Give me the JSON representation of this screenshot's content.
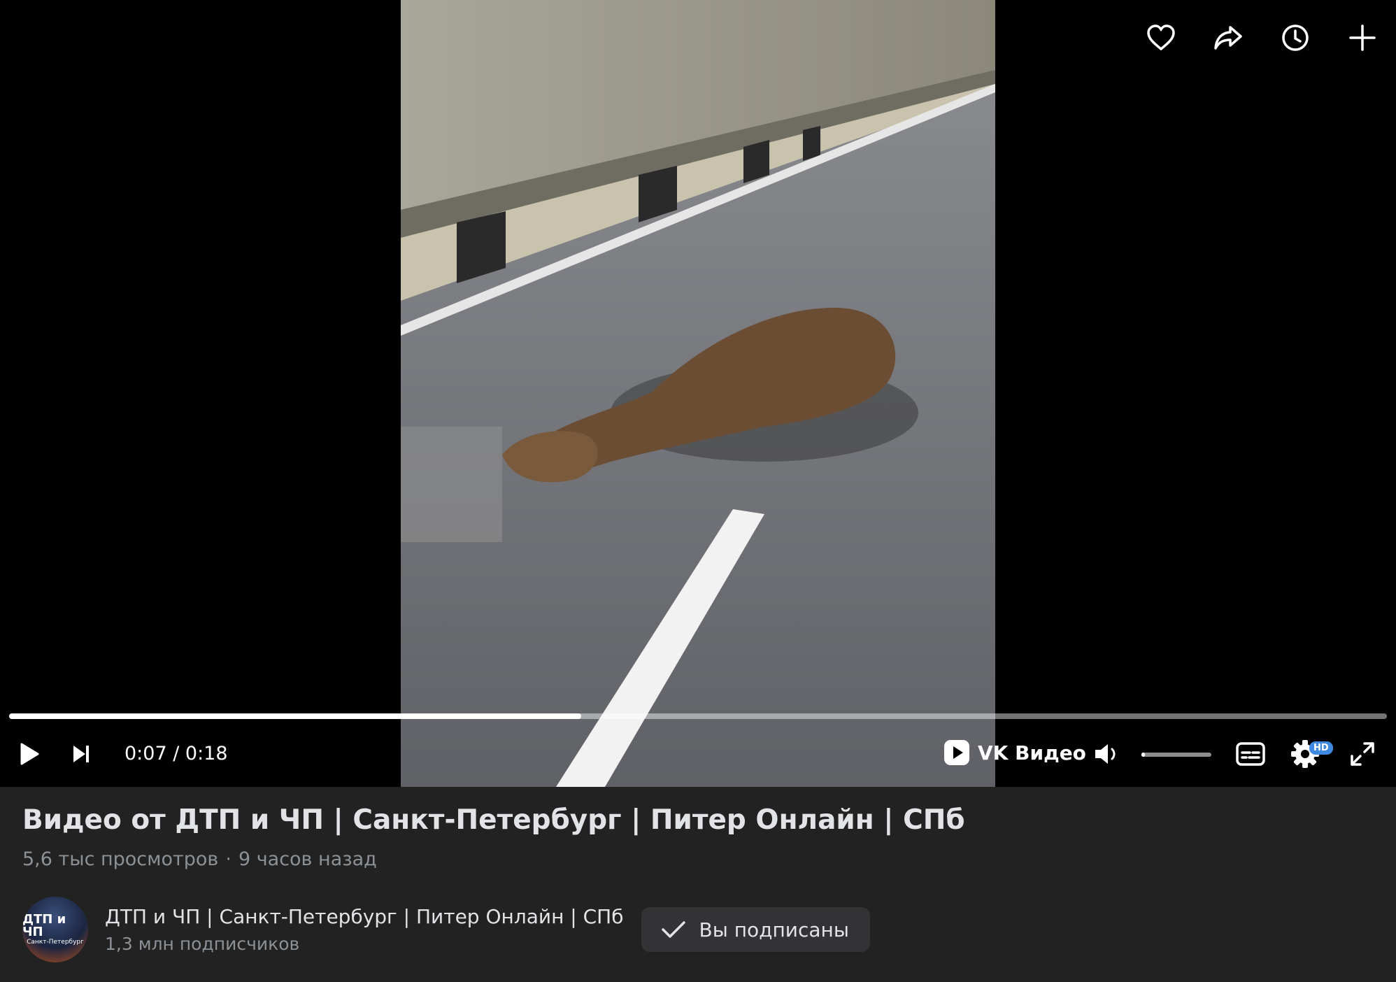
{
  "player": {
    "time_current": "0:07",
    "time_separator": " / ",
    "time_duration": "0:18",
    "progress_fraction": 0.415,
    "volume_fraction": 0.05,
    "brand_label": "VK Видео",
    "hd_badge": "HD",
    "top_icons": [
      "heart-icon",
      "share-icon",
      "clock-icon",
      "plus-icon"
    ],
    "control_icons": [
      "play-icon",
      "next-icon",
      "vk-video-logo-icon",
      "volume-icon",
      "subtitles-icon",
      "settings-icon",
      "fullscreen-icon"
    ]
  },
  "video": {
    "title": "Видео от ДТП и ЧП | Санкт-Петербург | Питер Онлайн | СПб",
    "views": "5,6 тыс просмотров",
    "separator": "·",
    "age": "9 часов назад"
  },
  "channel": {
    "name": "ДТП и ЧП | Санкт-Петербург | Питер Онлайн | СПб",
    "subscribers": "1,3 млн подписчиков",
    "avatar_line1": "ДТП и ЧП",
    "avatar_line2": "Санкт-Петербург",
    "subscribe_label": "Вы подписаны"
  },
  "colors": {
    "page_bg": "#222222",
    "accent": "#3f8ae0"
  }
}
